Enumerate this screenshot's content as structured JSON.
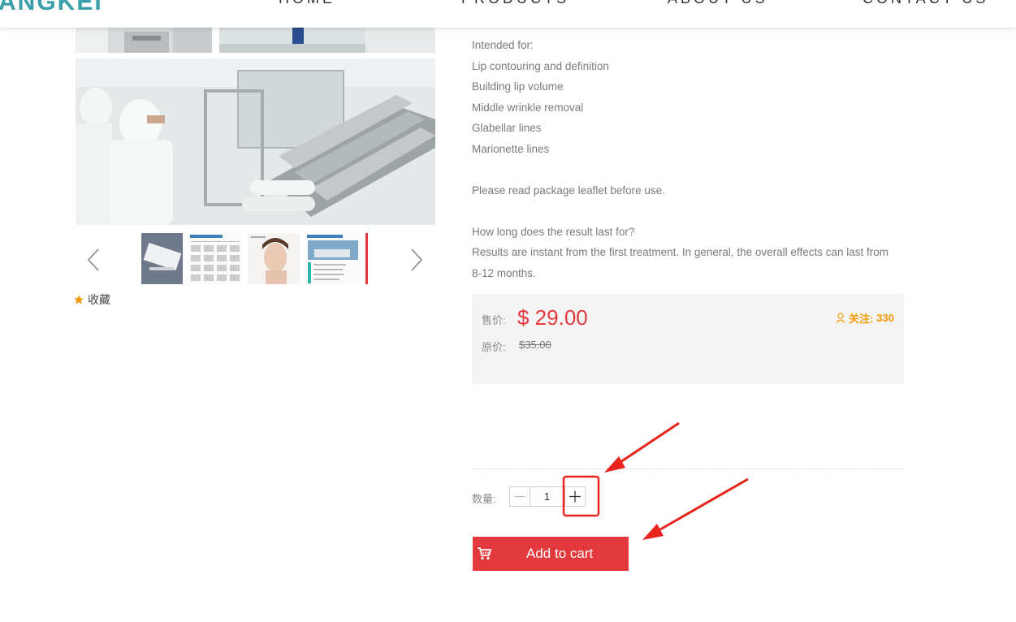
{
  "header": {
    "logo": "ANGKEI",
    "nav": [
      {
        "label": "HOME"
      },
      {
        "label": "PRODUCTS"
      },
      {
        "label": "ABOUT US"
      },
      {
        "label": "CONTACT US"
      }
    ]
  },
  "gallery": {
    "favorite_label": "收藏",
    "thumbnails": [
      {
        "name": "product-box"
      },
      {
        "name": "product-description-sheet",
        "caption": "PRODUCT DESCRIPTION"
      },
      {
        "name": "model-face"
      },
      {
        "name": "company-information",
        "caption": "COMPANY INFORMATION"
      },
      {
        "name": "partial"
      }
    ]
  },
  "description": {
    "lines": [
      "Intended for:",
      "Lip contouring and definition",
      "Building lip volume",
      "Middle wrinkle removal",
      "Glabellar lines",
      "Marionette lines",
      "",
      "Please read package leaflet before use.",
      "",
      "How long does the result last for?",
      "Results are instant from the first treatment. In general, the overall effects can last from",
      "8-12 months."
    ]
  },
  "price": {
    "sale_label": "售价:",
    "sale_price": "$ 29.00",
    "original_label": "原价:",
    "original_price": "$35.00",
    "follow_label": "关注:",
    "follow_count": "330"
  },
  "quantity": {
    "label": "数量:",
    "value": "1",
    "minus": "−",
    "plus": "+"
  },
  "cart": {
    "button_label": "Add to cart"
  },
  "colors": {
    "accent": "#e4393c",
    "follow": "#f39800",
    "annotation": "#e8241c"
  }
}
